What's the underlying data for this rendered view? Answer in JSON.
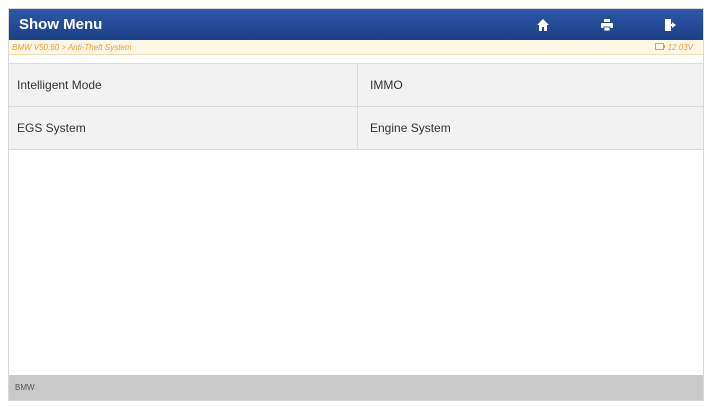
{
  "header": {
    "title": "Show Menu",
    "icons": [
      "home-icon",
      "print-icon",
      "exit-icon"
    ]
  },
  "info_bar": {
    "breadcrumb": "BMW V50.60 > Anti-Theft System",
    "voltage": "12.03V",
    "text_color": "#f39a3c"
  },
  "menu": {
    "items": [
      {
        "label": "Intelligent Mode"
      },
      {
        "label": "IMMO"
      },
      {
        "label": "EGS System"
      },
      {
        "label": "Engine System"
      }
    ]
  },
  "footer": {
    "label": "BMW"
  },
  "colors": {
    "header_blue": "#2c57a8",
    "menu_background": "#f2f2f2",
    "footer_background": "#c9c9c9"
  }
}
